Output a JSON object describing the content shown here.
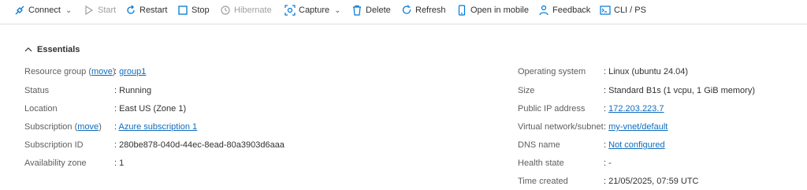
{
  "toolbar": {
    "items": [
      {
        "label": "Connect",
        "icon": "plug-icon",
        "disabled": false,
        "dropdown": true
      },
      {
        "label": "Start",
        "icon": "play-icon",
        "disabled": true,
        "dropdown": false
      },
      {
        "label": "Restart",
        "icon": "restart-icon",
        "disabled": false,
        "dropdown": false
      },
      {
        "label": "Stop",
        "icon": "stop-icon",
        "disabled": false,
        "dropdown": false
      },
      {
        "label": "Hibernate",
        "icon": "clock-icon",
        "disabled": true,
        "dropdown": false
      },
      {
        "label": "Capture",
        "icon": "capture-icon",
        "disabled": false,
        "dropdown": true
      },
      {
        "label": "Delete",
        "icon": "trash-icon",
        "disabled": false,
        "dropdown": false
      },
      {
        "label": "Refresh",
        "icon": "refresh-icon",
        "disabled": false,
        "dropdown": false
      },
      {
        "label": "Open in mobile",
        "icon": "mobile-icon",
        "disabled": false,
        "dropdown": false
      },
      {
        "label": "Feedback",
        "icon": "feedback-icon",
        "disabled": false,
        "dropdown": false
      },
      {
        "label": "CLI / PS",
        "icon": "cli-icon",
        "disabled": false,
        "dropdown": false
      }
    ]
  },
  "essentials": {
    "title": "Essentials",
    "left": [
      {
        "label": "Resource group",
        "label_link": "move",
        "value": "group1",
        "value_link": true
      },
      {
        "label": "Status",
        "value": "Running"
      },
      {
        "label": "Location",
        "value": "East US (Zone 1)"
      },
      {
        "label": "Subscription",
        "label_link": "move",
        "value": "Azure subscription 1",
        "value_link": true
      },
      {
        "label": "Subscription ID",
        "value": "280be878-040d-44ec-8ead-80a3903d6aaa"
      },
      {
        "label": "Availability zone",
        "value": "1"
      }
    ],
    "right": [
      {
        "label": "Operating system",
        "value": "Linux (ubuntu 24.04)"
      },
      {
        "label": "Size",
        "value": "Standard B1s (1 vcpu, 1 GiB memory)"
      },
      {
        "label": "Public IP address",
        "value": "172.203.223.7",
        "value_link": true
      },
      {
        "label": "Virtual network/subnet",
        "value": "my-vnet/default",
        "value_link": true
      },
      {
        "label": "DNS name",
        "value": "Not configured",
        "value_link": true
      },
      {
        "label": "Health state",
        "value": "-"
      },
      {
        "label": "Time created",
        "value": "21/05/2025, 07:59 UTC"
      }
    ]
  },
  "colors": {
    "link": "#0f6cbd",
    "accent": "#0078d4",
    "disabled": "#a19f9d"
  }
}
